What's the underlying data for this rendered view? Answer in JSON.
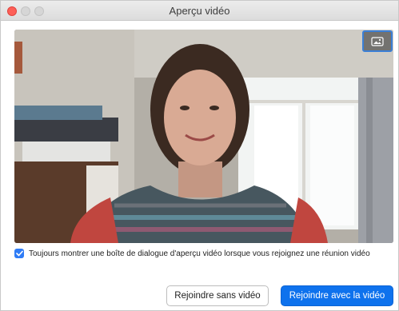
{
  "window": {
    "title": "Aperçu vidéo"
  },
  "preview": {
    "background_icon": "background-picture-icon"
  },
  "options": {
    "always_show_preview_label": "Toujours montrer une boîte de dialogue d'aperçu vidéo lorsque vous rejoignez une réunion vidéo",
    "always_show_preview_checked": true
  },
  "actions": {
    "join_without_video_label": "Rejoindre sans vidéo",
    "join_with_video_label": "Rejoindre avec la vidéo"
  },
  "colors": {
    "primary": "#0e72ed",
    "checkbox": "#2f7cf6",
    "close": "#fd5f57"
  }
}
